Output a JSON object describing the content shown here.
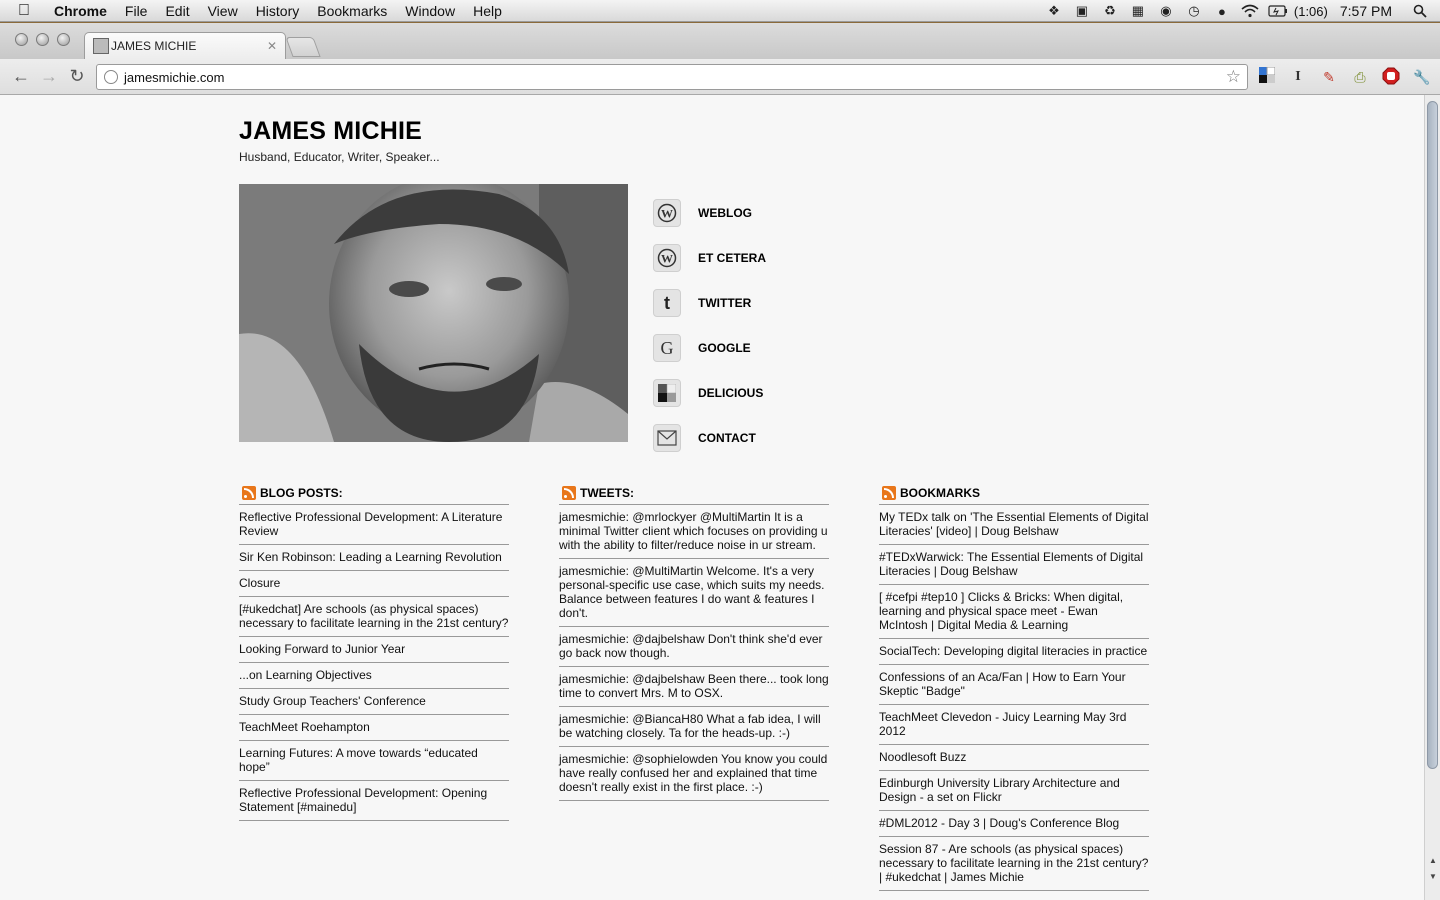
{
  "menubar": {
    "app": "Chrome",
    "items": [
      "File",
      "Edit",
      "View",
      "History",
      "Bookmarks",
      "Window",
      "Help"
    ],
    "battery": "(1:06)",
    "clock": "7:57 PM"
  },
  "browser": {
    "tab_title": "JAMES MICHIE",
    "url": "jamesmichie.com"
  },
  "site": {
    "title": "JAMES MICHIE",
    "tagline": "Husband, Educator, Writer, Speaker...",
    "links": [
      {
        "label": "WEBLOG",
        "icon": "wordpress-icon"
      },
      {
        "label": "ET CETERA",
        "icon": "wordpress-icon"
      },
      {
        "label": "TWITTER",
        "icon": "twitter-icon"
      },
      {
        "label": "GOOGLE",
        "icon": "google-icon"
      },
      {
        "label": "DELICIOUS",
        "icon": "delicious-icon"
      },
      {
        "label": "CONTACT",
        "icon": "envelope-icon"
      }
    ]
  },
  "columns": {
    "blog": {
      "title": "BLOG POSTS:",
      "items": [
        "Reflective Professional Development: A Literature Review",
        "Sir Ken Robinson: Leading a Learning Revolution",
        "Closure",
        "[#ukedchat] Are schools (as physical spaces) necessary to facilitate learning in the 21st century?",
        "Looking Forward to Junior Year",
        "...on Learning Objectives",
        "Study Group Teachers' Conference",
        "TeachMeet Roehampton",
        "Learning Futures: A move towards “educated hope”",
        "Reflective Professional Development: Opening Statement [#mainedu]"
      ]
    },
    "tweets": {
      "title": "TWEETS:",
      "items": [
        "jamesmichie: @mrlockyer @MultiMartin It is a minimal Twitter client which focuses on providing u with the ability to filter/reduce noise in ur stream.",
        "jamesmichie: @MultiMartin Welcome. It's a very personal-specific use case, which suits my needs. Balance between features I do want & features I don't.",
        "jamesmichie: @dajbelshaw Don't think she'd ever go back now though.",
        "jamesmichie: @dajbelshaw Been there... took long time to convert Mrs. M to OSX.",
        "jamesmichie: @BiancaH80 What a fab idea, I will be watching closely. Ta for the heads-up. :-)",
        "jamesmichie: @sophielowden You know you could have really confused her and explained that time doesn't really exist in the first place. :-)"
      ]
    },
    "bookmarks": {
      "title": "BOOKMARKS",
      "items": [
        "My TEDx talk on 'The Essential Elements of Digital Literacies' [video] | Doug Belshaw",
        "#TEDxWarwick: The Essential Elements of Digital Literacies | Doug Belshaw",
        "[ #cefpi #tep10 ] Clicks & Bricks: When digital, learning and physical space meet - Ewan McIntosh | Digital Media & Learning",
        "SocialTech: Developing digital literacies in practice",
        "Confessions of an Aca/Fan | How to Earn Your Skeptic \"Badge\"",
        "TeachMeet Clevedon - Juicy Learning May 3rd 2012",
        "Noodlesoft Buzz",
        "Edinburgh University Library Architecture and Design - a set on Flickr",
        "#DML2012 - Day 3 | Doug's Conference Blog",
        "Session 87 - Are schools (as physical spaces) necessary to facilitate learning in the 21st century? | #ukedchat | James Michie"
      ]
    }
  }
}
